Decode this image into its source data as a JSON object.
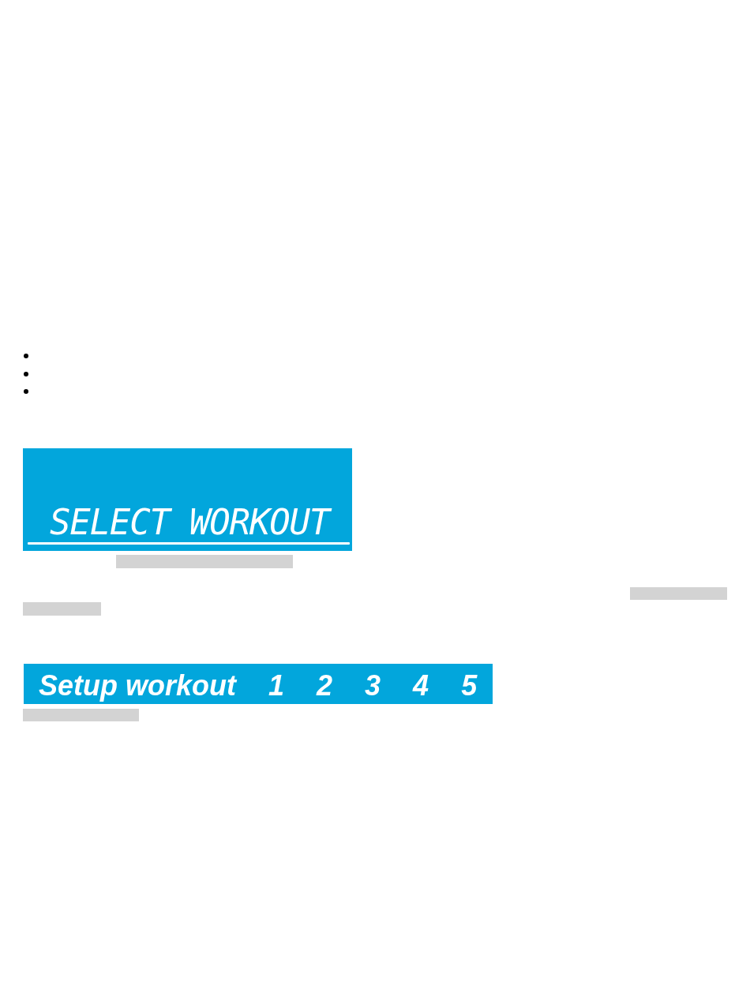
{
  "blocks": [
    {
      "kind": "bullet_list",
      "items": [
        {
          "kind": "bullet_point"
        },
        {
          "kind": "bullet_point"
        },
        {
          "kind": "bullet_point"
        }
      ]
    },
    {
      "kind": "lcd_display",
      "text": "SELECT WORKOUT"
    },
    {
      "kind": "redacted"
    },
    {
      "kind": "redacted"
    },
    {
      "kind": "redacted"
    },
    {
      "kind": "banner",
      "title": "Setup workout",
      "steps": [
        "1",
        "2",
        "3",
        "4",
        "5"
      ]
    },
    {
      "kind": "redacted"
    }
  ]
}
